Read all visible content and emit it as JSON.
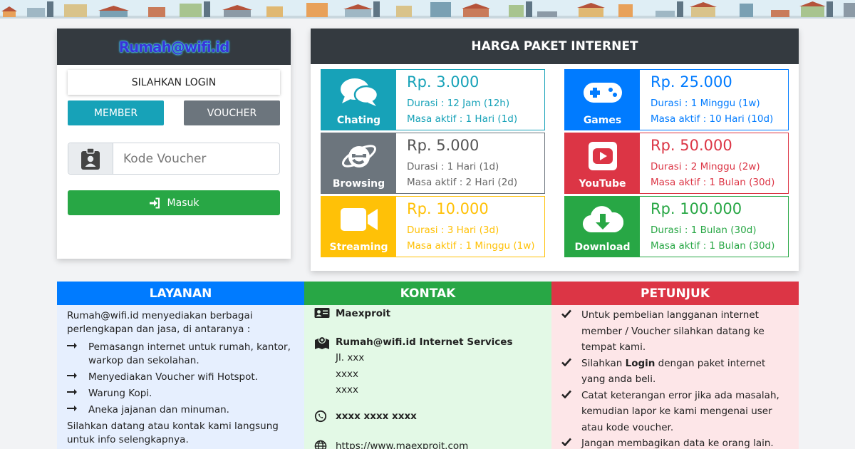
{
  "login": {
    "brand": "Rumah@wifi.id",
    "title": "SILAHKAN LOGIN",
    "member_label": "MEMBER",
    "voucher_label": "VOUCHER",
    "voucher_placeholder": "Kode Voucher",
    "submit_label": "Masuk"
  },
  "prices": {
    "title": "HARGA PAKET INTERNET",
    "packages": [
      {
        "name": "Chating",
        "price": "Rp. 3.000",
        "durasi": "Durasi : 12 Jam (12h)",
        "aktif": "Masa aktif : 1 Hari (1d)",
        "color": "#17a2b8",
        "icon": "chat-icon"
      },
      {
        "name": "Games",
        "price": "Rp. 25.000",
        "durasi": "Durasi : 1 Minggu (1w)",
        "aktif": "Masa aktif : 10 Hari (10d)",
        "color": "#007bff",
        "icon": "gamepad-icon"
      },
      {
        "name": "Browsing",
        "price": "Rp. 5.000",
        "durasi": "Durasi : 1 Hari (1d)",
        "aktif": "Masa aktif : 2 Hari (2d)",
        "color": "#6c757d",
        "icon": "browser-icon"
      },
      {
        "name": "YouTube",
        "price": "Rp. 50.000",
        "durasi": "Durasi : 2 Minggu (2w)",
        "aktif": "Masa aktif : 1 Bulan (30d)",
        "color": "#dc3545",
        "icon": "youtube-icon"
      },
      {
        "name": "Streaming",
        "price": "Rp. 10.000",
        "durasi": "Durasi : 3 Hari (3d)",
        "aktif": "Masa aktif : 1 Minggu (1w)",
        "color": "#ffc107",
        "icon": "video-camera-icon"
      },
      {
        "name": "Download",
        "price": "Rp. 100.000",
        "durasi": "Durasi : 1 Bulan (30d)",
        "aktif": "Masa aktif : 1 Bulan (30d)",
        "color": "#28a745",
        "icon": "cloud-download-icon"
      }
    ]
  },
  "layanan": {
    "title": "LAYANAN",
    "color": "#007bff",
    "bg": "#e6effe",
    "intro": "Rumah@wifi.id menyediakan berbagai perlengkapan dan jasa, di antaranya :",
    "items": [
      "Pemasangn internet untuk rumah, kantor, warkop dan sekolahan.",
      "Menyediakan Voucher wifi Hotspot.",
      "Warung Kopi.",
      "Aneka jajanan dan minuman."
    ],
    "outro": "Silahkan datang atau kontak kami langsung untuk info selengkapnya."
  },
  "kontak": {
    "title": "KONTAK",
    "color": "#28a745",
    "bg": "#e3f9e6",
    "name": "Maexproit",
    "company": "Rumah@wifi.id Internet Services",
    "address": [
      "Jl. xxx",
      "xxxx",
      "xxxx"
    ],
    "phone": "xxxx xxxx xxxx",
    "website": "https://www.maexproit.com"
  },
  "petunjuk": {
    "title": "PETUNJUK",
    "color": "#dc3545",
    "bg": "#fde6e8",
    "items": [
      {
        "pre": "Untuk pembelian langganan internet member / Voucher silahkan datang ke tempat kami.",
        "bold": "",
        "post": ""
      },
      {
        "pre": "Silahkan ",
        "bold": "Login",
        "post": " dengan paket internet yang anda beli."
      },
      {
        "pre": "Catat keterangan error jika ada masalah, kemudian lapor ke kami mengenai user atau kode voucher.",
        "bold": "",
        "post": ""
      },
      {
        "pre": "Jangan membagikan data ke orang lain.",
        "bold": "",
        "post": ""
      }
    ]
  }
}
